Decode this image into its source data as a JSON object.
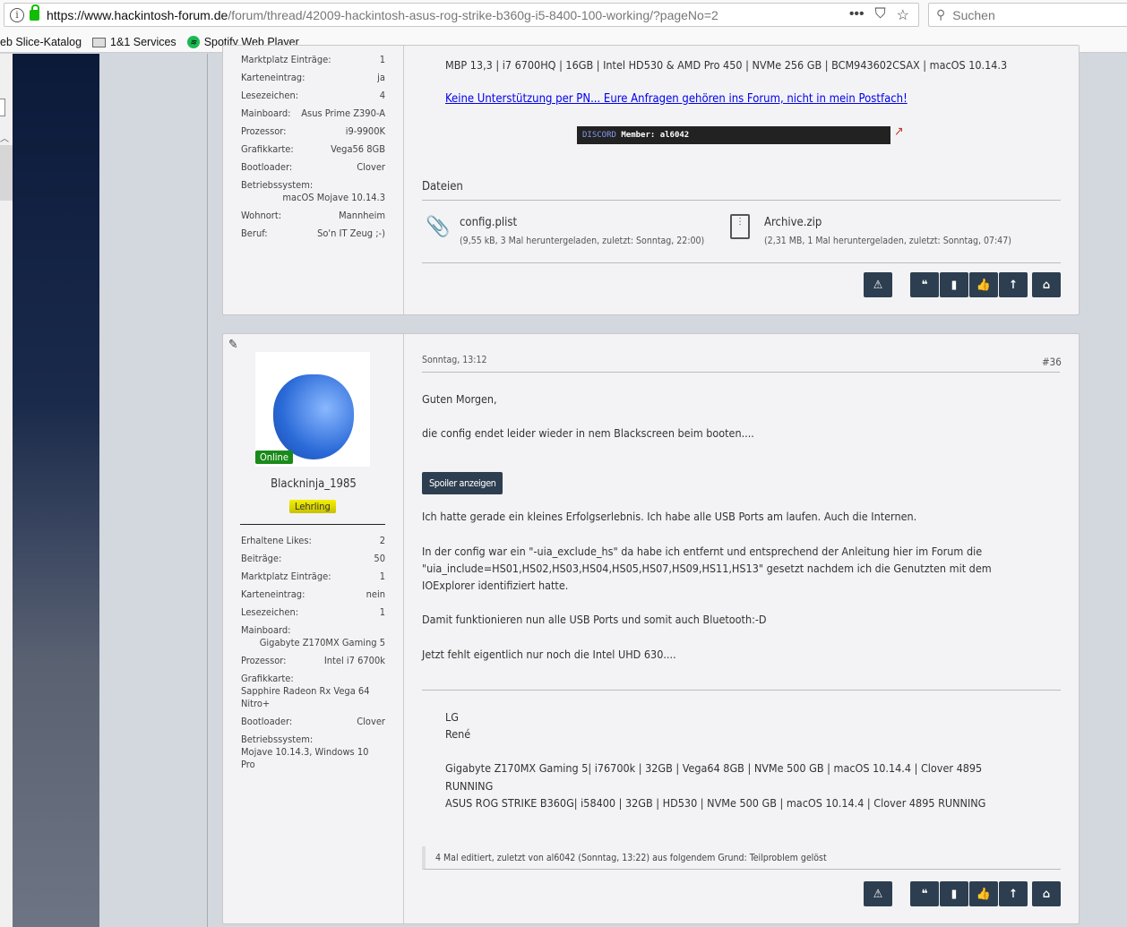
{
  "browser": {
    "url_host": "https://www.hackintosh-forum.de",
    "url_path": "/forum/thread/42009-hackintosh-asus-rog-strike-b360g-i5-8400-100-working/?pageNo=2",
    "search_placeholder": "Suchen",
    "bookmarks": [
      "eb Slice-Katalog",
      "1&1 Services",
      "Spotify Web Player"
    ]
  },
  "post1": {
    "profile": [
      [
        "Marktplatz Einträge:",
        "1"
      ],
      [
        "Karteneintrag:",
        "ja"
      ],
      [
        "Lesezeichen:",
        "4"
      ],
      [
        "Mainboard:",
        "Asus Prime Z390-A"
      ],
      [
        "Prozessor:",
        "i9-9900K"
      ],
      [
        "Grafikkarte:",
        "Vega56 8GB"
      ],
      [
        "Bootloader:",
        "Clover"
      ],
      [
        "Betriebssystem:",
        "macOS Mojave 10.14.3"
      ],
      [
        "Wohnort:",
        "Mannheim"
      ],
      [
        "Beruf:",
        "So'n IT Zeug ;-)"
      ]
    ],
    "signature": "MBP 13,3 | i7 6700HQ | 16GB | Intel HD530 & AMD Pro 450 | NVMe 256 GB | BCM943602CSAX | macOS 10.14.3",
    "link": "Keine Unterstützung per PN... Eure Anfragen gehören ins Forum, nicht in mein Postfach!",
    "discord_label": "DISCORD",
    "discord_member": "Member: al6042",
    "files_title": "Dateien",
    "files": [
      {
        "name": "config.plist",
        "meta": "(9,55 kB, 3 Mal heruntergeladen, zuletzt: Sonntag, 22:00)"
      },
      {
        "name": "Archive.zip",
        "meta": "(2,31 MB, 1 Mal heruntergeladen, zuletzt: Sonntag, 07:47)"
      }
    ]
  },
  "post2": {
    "username": "Blackninja_1985",
    "status": "Online",
    "rank": "Lehrling",
    "profile": [
      [
        "Erhaltene Likes:",
        "2"
      ],
      [
        "Beiträge:",
        "50"
      ],
      [
        "Marktplatz Einträge:",
        "1"
      ],
      [
        "Karteneintrag:",
        "nein"
      ],
      [
        "Lesezeichen:",
        "1"
      ],
      [
        "Mainboard:",
        "Gigabyte Z170MX Gaming 5"
      ],
      [
        "Prozessor:",
        "Intel i7 6700k"
      ],
      [
        "Grafikkarte:",
        "Sapphire Radeon Rx Vega 64 Nitro+"
      ],
      [
        "Bootloader:",
        "Clover"
      ],
      [
        "Betriebssystem:",
        "Mojave 10.14.3, Windows 10 Pro"
      ]
    ],
    "date": "Sonntag, 13:12",
    "number": "#36",
    "paragraphs": [
      "Guten Morgen,",
      "die config endet leider wieder in nem Blackscreen beim booten....",
      "Ich hatte gerade ein kleines Erfolgserlebnis. Ich habe alle USB Ports am laufen. Auch die Internen.",
      "In der config war ein \"-uia_exclude_hs\" da habe ich entfernt und entsprechend der Anleitung hier im Forum die",
      "\"uia_include=HS01,HS02,HS03,HS04,HS05,HS07,HS09,HS11,HS13\" gesetzt nachdem ich die Genutzten mit dem",
      "IOExplorer identifiziert hatte.",
      "Damit funktionieren nun alle USB Ports und somit auch Bluetooth:-D",
      "Jetzt fehlt eigentlich nur noch die Intel UHD 630...."
    ],
    "spoiler": "Spoiler anzeigen",
    "signature": [
      "LG",
      "René",
      "Gigabyte Z170MX Gaming 5| i76700k | 32GB | Vega64 8GB | NVMe 500 GB | macOS 10.14.4 | Clover 4895",
      "RUNNING",
      "ASUS ROG STRIKE B360G| i58400 | 32GB | HD530 | NVMe 500 GB | macOS 10.14.4 | Clover 4895 RUNNING"
    ],
    "edit_note": "4 Mal editiert, zuletzt von al6042 (Sonntag, 13:22) aus folgendem Grund: Teilproblem gelöst"
  },
  "colors": {
    "button": "#2d3e50",
    "online": "#1a8a1a",
    "rank": "#e8e000",
    "link": "#0000ee"
  }
}
